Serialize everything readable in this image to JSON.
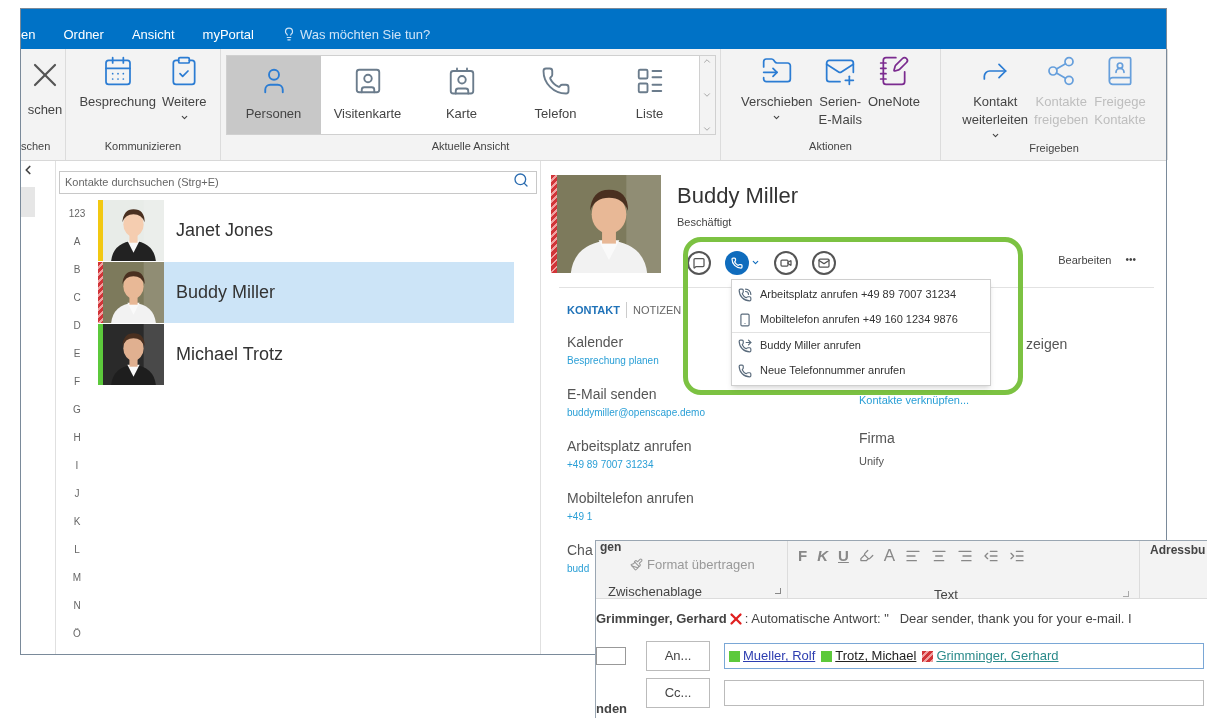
{
  "menu_bar": {
    "tabs": [
      {
        "label": "en"
      },
      {
        "label": "Ordner"
      },
      {
        "label": "Ansicht"
      },
      {
        "label": "myPortal"
      }
    ],
    "tell_me": "Was möchten Sie tun?"
  },
  "ribbon": {
    "groups": [
      {
        "label": "schen",
        "kind": "buttons",
        "buttons": [
          {
            "label": "schen",
            "caret": false,
            "disabled": false
          }
        ]
      },
      {
        "label": "Kommunizieren",
        "kind": "buttons",
        "buttons": [
          {
            "label": "Besprechung",
            "caret": false,
            "disabled": false
          },
          {
            "label": "Weitere",
            "caret": true,
            "disabled": false
          }
        ]
      },
      {
        "label": "Aktuelle Ansicht",
        "kind": "gallery",
        "buttons": [
          {
            "label": "Personen",
            "selected": true
          },
          {
            "label": "Visitenkarte",
            "selected": false
          },
          {
            "label": "Karte",
            "selected": false
          },
          {
            "label": "Telefon",
            "selected": false
          },
          {
            "label": "Liste",
            "selected": false
          }
        ]
      },
      {
        "label": "Aktionen",
        "kind": "buttons",
        "buttons": [
          {
            "label": "Verschieben",
            "caret": true,
            "disabled": false
          },
          {
            "label": "Serien-\nE-Mails",
            "caret": false,
            "disabled": false
          },
          {
            "label": "OneNote",
            "caret": false,
            "disabled": false
          }
        ]
      },
      {
        "label": "Freigeben",
        "kind": "buttons",
        "buttons": [
          {
            "label": "Kontakt\nweiterleiten",
            "caret": true,
            "disabled": false
          },
          {
            "label": "Kontakte\nfreigeben",
            "caret": false,
            "disabled": true
          },
          {
            "label": "Freigege\nKontakte",
            "caret": false,
            "disabled": true
          }
        ]
      }
    ]
  },
  "contacts": {
    "search": {
      "placeholder": "Kontakte durchsuchen (Strg+E)"
    },
    "index": [
      "123",
      "A",
      "B",
      "C",
      "D",
      "E",
      "F",
      "G",
      "H",
      "I",
      "J",
      "K",
      "L",
      "M",
      "N",
      "Ö"
    ],
    "items": [
      {
        "name": "Janet Jones",
        "color": "#f2c811",
        "striped": false,
        "selected": false
      },
      {
        "name": "Buddy Miller",
        "color": "#d13438",
        "striped": true,
        "selected": true
      },
      {
        "name": "Michael Trotz",
        "color": "#5cc93b",
        "striped": false,
        "selected": false
      }
    ]
  },
  "detail": {
    "name": "Buddy Miller",
    "status": "Beschäftigt",
    "color": "#d13438",
    "striped": true,
    "actions": [
      {
        "selected": false,
        "caret": false
      },
      {
        "selected": true,
        "caret": true
      },
      {
        "selected": false,
        "caret": false
      },
      {
        "selected": false,
        "caret": false
      }
    ],
    "edit": "Bearbeiten",
    "more": "•••",
    "tabs": [
      {
        "label": "KONTAKT",
        "selected": true
      },
      {
        "label": "NOTIZEN",
        "selected": false
      }
    ],
    "left_fields": [
      {
        "label": "Kalender",
        "value": "Besprechung planen"
      },
      {
        "label": "E-Mail senden",
        "value": "buddymiller@openscape.demo"
      },
      {
        "label": "Arbeitsplatz anrufen",
        "value": "+49 89 7007 31234"
      },
      {
        "label": "Mobiltelefon anrufen",
        "value": "+49 1"
      },
      {
        "label": "Cha",
        "value": "budd"
      }
    ],
    "right_fields": [
      {
        "label": "zeigen"
      },
      {
        "value": "Kontakte verknüpfen...",
        "kind": "link"
      },
      {
        "label": "Firma",
        "value": "Unify",
        "kind": "plain"
      }
    ]
  },
  "call_menu": {
    "sections": [
      [
        {
          "label": "Arbeitsplatz anrufen +49 89 7007 31234"
        },
        {
          "label": "Mobiltelefon anrufen +49 160 1234 9876"
        }
      ],
      [
        {
          "label": "Buddy Miller anrufen"
        },
        {
          "label": "Neue Telefonnummer anrufen"
        }
      ]
    ]
  },
  "compose": {
    "clipboard": {
      "paste": "gen",
      "format_painter": "Format übertragen",
      "label": "Zwischenablage"
    },
    "text": {
      "styles": [
        "F",
        "K",
        "U"
      ],
      "font_color": "A",
      "label": "Text"
    },
    "address_book": "Adressbu",
    "info": {
      "sender": "Grimminger, Gerhard",
      "message": ": Automatische Antwort: \"   Dear sender, thank you for your e-mail. I"
    },
    "to_button": "An...",
    "to": [
      {
        "name": "Mueller, Rolf",
        "color": "#5cc93b",
        "striped": false
      },
      {
        "name": "Trotz, Michael",
        "color": "#5cc93b",
        "striped": false
      },
      {
        "name": "Grimminger, Gerhard",
        "color": "#d13438",
        "striped": true
      }
    ],
    "cc_button": "Cc...",
    "send": "nden"
  }
}
